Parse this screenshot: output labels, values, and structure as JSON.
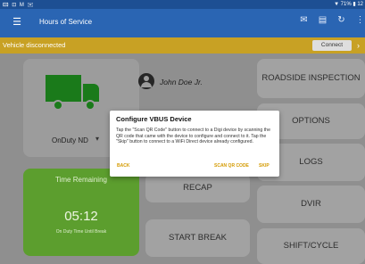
{
  "status_bar": {
    "left": "🖾 ⊡ M ✉",
    "right": "▼ 71% ▮ 12"
  },
  "app_bar": {
    "menu_icon": "hamburger-icon",
    "title": "Hours of Service",
    "actions": [
      "message-icon",
      "document-icon",
      "refresh-icon",
      "more-icon"
    ]
  },
  "banner": {
    "text": "Vehicle disconnected",
    "connect_label": "Connect",
    "color": "#c8a124"
  },
  "duty": {
    "status": "OnDuty ND",
    "truck_color": "#1a7a1a"
  },
  "user": {
    "name": "John Doe Jr."
  },
  "remaining": {
    "title": "Time Remaining",
    "time": "05:12",
    "subtitle": "On Duty Time Until Break"
  },
  "center_buttons": {
    "recap": "RECAP",
    "start_break": "START BREAK"
  },
  "side_buttons": {
    "roadside": "ROADSIDE INSPECTION",
    "options": "OPTIONS",
    "logs": "LOGS",
    "dvir": "DVIR",
    "shift": "SHIFT/CYCLE"
  },
  "dialog": {
    "title": "Configure VBUS Device",
    "body": "Tap the \"Scan QR Code\" button to connect to a Digi device by scanning the QR code that came with the device to configure and connect to it. Tap the \"Skip\" button to connect to a WiFi Direct device already configured.",
    "back": "BACK",
    "scan": "SCAN QR CODE",
    "skip": "SKIP",
    "accent": "#d49a00"
  }
}
